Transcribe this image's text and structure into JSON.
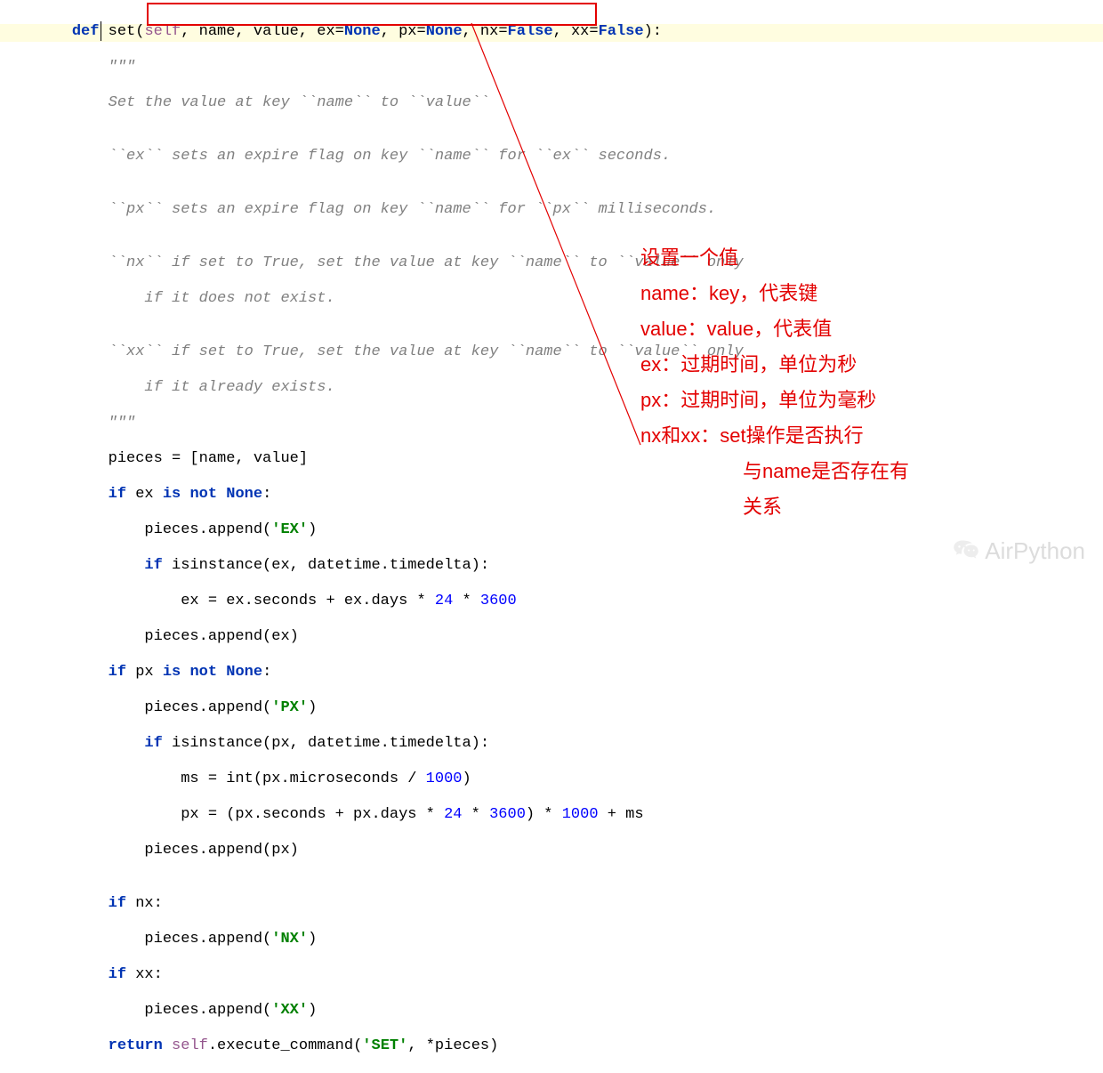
{
  "code": {
    "l1_def": "def",
    "l1_set": " set",
    "l1_open": "(",
    "l1_self": "self",
    "l1_args_a": ", name, value, ex=",
    "l1_none1": "None",
    "l1_args_b": ", px=",
    "l1_none2": "None",
    "l1_args_c": ", nx=",
    "l1_false1": "False",
    "l1_args_d": ", xx=",
    "l1_false2": "False",
    "l1_close": "):",
    "l2": "        \"\"\"",
    "l3": "        Set the value at key ``name`` to ``value``",
    "l4": "",
    "l5": "        ``ex`` sets an expire flag on key ``name`` for ``ex`` seconds.",
    "l6": "",
    "l7": "        ``px`` sets an expire flag on key ``name`` for ``px`` milliseconds.",
    "l8": "",
    "l9": "        ``nx`` if set to True, set the value at key ``name`` to ``value`` only",
    "l10": "            if it does not exist.",
    "l11": "",
    "l12": "        ``xx`` if set to True, set the value at key ``name`` to ``value`` only",
    "l13": "            if it already exists.",
    "l14": "        \"\"\"",
    "l15": "        pieces = [name, value]",
    "l16_a": "        ",
    "l16_if": "if",
    "l16_b": " ex ",
    "l16_isnot": "is not ",
    "l16_none": "None",
    "l16_c": ":",
    "l17_a": "            pieces.append(",
    "l17_s": "'EX'",
    "l17_b": ")",
    "l18_a": "            ",
    "l18_if": "if",
    "l18_b": " isinstance(ex, datetime.timedelta):",
    "l19_a": "                ex = ex.seconds + ex.days * ",
    "l19_n1": "24",
    "l19_b": " * ",
    "l19_n2": "3600",
    "l20": "            pieces.append(ex)",
    "l21_a": "        ",
    "l21_if": "if",
    "l21_b": " px ",
    "l21_isnot": "is not ",
    "l21_none": "None",
    "l21_c": ":",
    "l22_a": "            pieces.append(",
    "l22_s": "'PX'",
    "l22_b": ")",
    "l23_a": "            ",
    "l23_if": "if",
    "l23_b": " isinstance(px, datetime.timedelta):",
    "l24_a": "                ms = int(px.microseconds / ",
    "l24_n": "1000",
    "l24_b": ")",
    "l25_a": "                px = (px.seconds + px.days * ",
    "l25_n1": "24",
    "l25_b": " * ",
    "l25_n2": "3600",
    "l25_c": ") * ",
    "l25_n3": "1000",
    "l25_d": " + ms",
    "l26": "            pieces.append(px)",
    "l27": "",
    "l28_a": "        ",
    "l28_if": "if",
    "l28_b": " nx:",
    "l29_a": "            pieces.append(",
    "l29_s": "'NX'",
    "l29_b": ")",
    "l30_a": "        ",
    "l30_if": "if",
    "l30_b": " xx:",
    "l31_a": "            pieces.append(",
    "l31_s": "'XX'",
    "l31_b": ")",
    "l32_a": "        ",
    "l32_ret": "return ",
    "l32_self": "self",
    "l32_b": ".execute_command(",
    "l32_s": "'SET'",
    "l32_c": ", *pieces)"
  },
  "annotations": {
    "a1": "设置一个值",
    "a2": "name：key，代表键",
    "a3": "value：value，代表值",
    "a4": "ex：过期时间，单位为秒",
    "a5": "px：过期时间，单位为毫秒",
    "a6": "nx和xx：set操作是否执行",
    "a7": "与name是否存在有",
    "a8": "关系"
  },
  "watermark": "AirPython"
}
